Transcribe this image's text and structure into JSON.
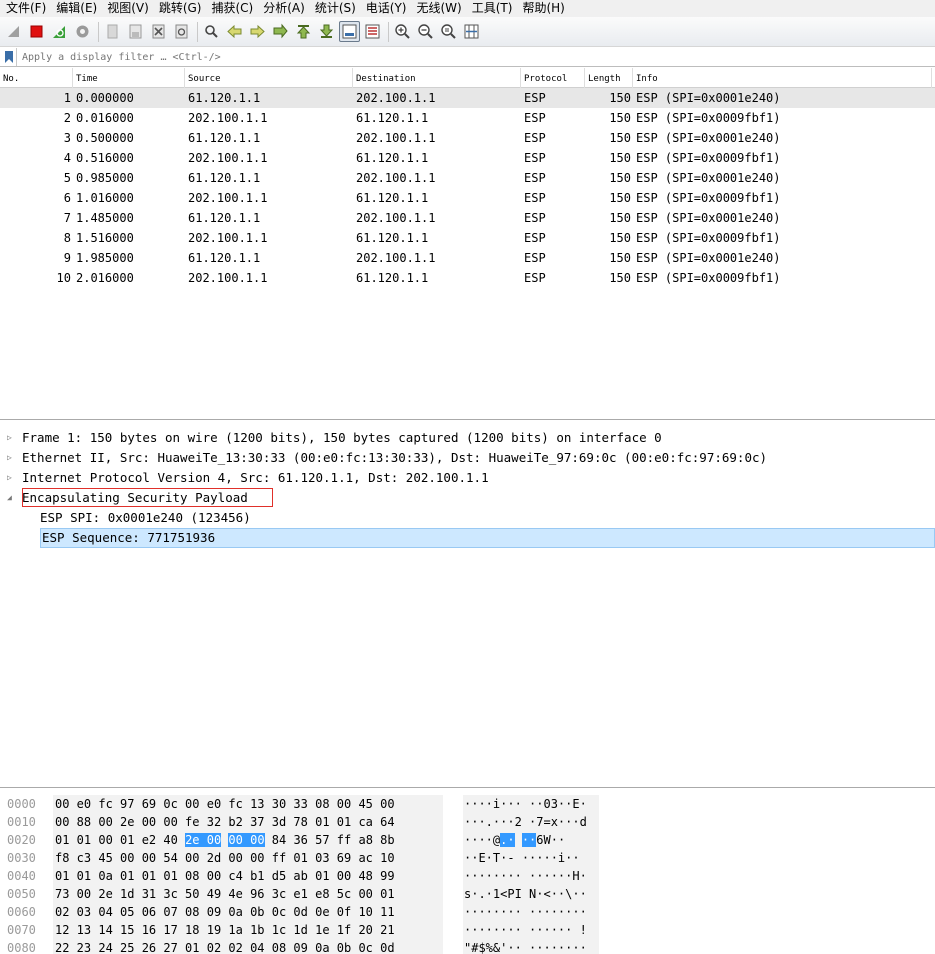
{
  "menu": [
    "文件(F)",
    "编辑(E)",
    "视图(V)",
    "跳转(G)",
    "捕获(C)",
    "分析(A)",
    "统计(S)",
    "电话(Y)",
    "无线(W)",
    "工具(T)",
    "帮助(H)"
  ],
  "filter": {
    "placeholder": "Apply a display filter … <Ctrl-/>"
  },
  "columns": [
    "No.",
    "Time",
    "Source",
    "Destination",
    "Protocol",
    "Length",
    "Info"
  ],
  "packets": [
    {
      "no": "1",
      "time": "0.000000",
      "src": "61.120.1.1",
      "dst": "202.100.1.1",
      "proto": "ESP",
      "len": "150",
      "info": "ESP (SPI=0x0001e240)"
    },
    {
      "no": "2",
      "time": "0.016000",
      "src": "202.100.1.1",
      "dst": "61.120.1.1",
      "proto": "ESP",
      "len": "150",
      "info": "ESP (SPI=0x0009fbf1)"
    },
    {
      "no": "3",
      "time": "0.500000",
      "src": "61.120.1.1",
      "dst": "202.100.1.1",
      "proto": "ESP",
      "len": "150",
      "info": "ESP (SPI=0x0001e240)"
    },
    {
      "no": "4",
      "time": "0.516000",
      "src": "202.100.1.1",
      "dst": "61.120.1.1",
      "proto": "ESP",
      "len": "150",
      "info": "ESP (SPI=0x0009fbf1)"
    },
    {
      "no": "5",
      "time": "0.985000",
      "src": "61.120.1.1",
      "dst": "202.100.1.1",
      "proto": "ESP",
      "len": "150",
      "info": "ESP (SPI=0x0001e240)"
    },
    {
      "no": "6",
      "time": "1.016000",
      "src": "202.100.1.1",
      "dst": "61.120.1.1",
      "proto": "ESP",
      "len": "150",
      "info": "ESP (SPI=0x0009fbf1)"
    },
    {
      "no": "7",
      "time": "1.485000",
      "src": "61.120.1.1",
      "dst": "202.100.1.1",
      "proto": "ESP",
      "len": "150",
      "info": "ESP (SPI=0x0001e240)"
    },
    {
      "no": "8",
      "time": "1.516000",
      "src": "202.100.1.1",
      "dst": "61.120.1.1",
      "proto": "ESP",
      "len": "150",
      "info": "ESP (SPI=0x0009fbf1)"
    },
    {
      "no": "9",
      "time": "1.985000",
      "src": "61.120.1.1",
      "dst": "202.100.1.1",
      "proto": "ESP",
      "len": "150",
      "info": "ESP (SPI=0x0001e240)"
    },
    {
      "no": "10",
      "time": "2.016000",
      "src": "202.100.1.1",
      "dst": "61.120.1.1",
      "proto": "ESP",
      "len": "150",
      "info": "ESP (SPI=0x0009fbf1)"
    }
  ],
  "details": [
    {
      "text": "Frame 1: 150 bytes on wire (1200 bits), 150 bytes captured (1200 bits) on interface 0",
      "tri": "▷"
    },
    {
      "text": "Ethernet II, Src: HuaweiTe_13:30:33 (00:e0:fc:13:30:33), Dst: HuaweiTe_97:69:0c (00:e0:fc:97:69:0c)",
      "tri": "▷"
    },
    {
      "text": "Internet Protocol Version 4, Src: 61.120.1.1, Dst: 202.100.1.1",
      "tri": "▷"
    },
    {
      "text": "Encapsulating Security Payload",
      "tri": "◢"
    },
    {
      "text": "ESP SPI: 0x0001e240 (123456)",
      "tri": ""
    },
    {
      "text": "ESP Sequence: 771751936",
      "tri": ""
    }
  ],
  "hex": [
    {
      "off": "0000",
      "a": "00 e0 fc 97 69 0c 00 e0",
      "b": "fc 13 30 33 08 00 45 00",
      "asc1": "····i···",
      "asc2": "··03··E·"
    },
    {
      "off": "0010",
      "a": "00 88 00 2e 00 00 fe 32",
      "b": "b2 37 3d 78 01 01 ca 64",
      "asc1": "···.···2",
      "asc2": "·7=x···d"
    },
    {
      "off": "0020",
      "a": "01 01 00 01 e2 40",
      "hl": "2e 00",
      "b_hl": "00 00",
      "b": "84 36 57 ff a8 8b",
      "asc1": "····@",
      "asc1_hl": ".·",
      "asc2_hl": "··",
      "asc2": "6W··"
    },
    {
      "off": "0030",
      "a": "f8 c3 45 00 00 54 00 2d",
      "b": "00 00 ff 01 03 69 ac 10",
      "asc1": "··E·T·-",
      "asc2": "·····i··"
    },
    {
      "off": "0040",
      "a": "01 01 0a 01 01 01 08 00",
      "b": "c4 b1 d5 ab 01 00 48 99",
      "asc1": "········",
      "asc2": "······H·"
    },
    {
      "off": "0050",
      "a": "73 00 2e 1d 31 3c 50 49",
      "b": "4e 96 3c e1 e8 5c 00 01",
      "asc1": "s·.·1<PI",
      "asc2": "N·<··\\··"
    },
    {
      "off": "0060",
      "a": "02 03 04 05 06 07 08 09",
      "b": "0a 0b 0c 0d 0e 0f 10 11",
      "asc1": "········",
      "asc2": "········"
    },
    {
      "off": "0070",
      "a": "12 13 14 15 16 17 18 19",
      "b": "1a 1b 1c 1d 1e 1f 20 21",
      "asc1": "········",
      "asc2": "······ !"
    },
    {
      "off": "0080",
      "a": "22 23 24 25 26 27 01 02",
      "b": "02 04 08 09 0a 0b 0c 0d",
      "asc1": "\"#$%&'··",
      "asc2": "········"
    }
  ],
  "colors": {
    "selection_hex": "#3399ff",
    "detail_selection": "#cde8ff",
    "highlight_border": "#e0302a"
  }
}
